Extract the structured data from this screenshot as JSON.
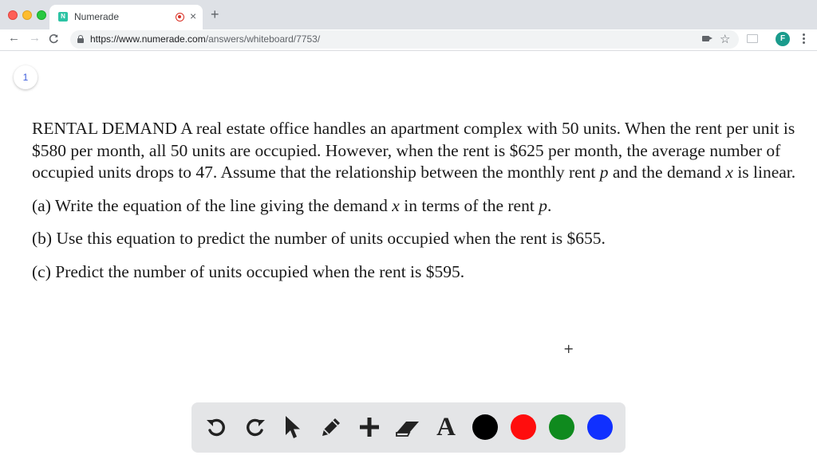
{
  "browser": {
    "tab": {
      "favicon": "N",
      "title": "Numerade",
      "close": "×"
    },
    "new_tab": "+",
    "nav": {
      "back": "←",
      "forward": "→",
      "reload": "C"
    },
    "address": {
      "host": "https://www.numerade.com",
      "path": "/answers/whiteboard/7753/"
    },
    "star": "☆",
    "profile_initial": "F"
  },
  "page": {
    "page_number": "1",
    "problem": {
      "intro_a": "RENTAL DEMAND A real estate office handles an apartment complex with 50 units. When the rent per unit is $580 per month, all 50 units are occupied. However, when the rent is $625 per month, the average number of occupied units drops to 47. Assume that the relationship between the monthly rent ",
      "intro_var_p": "p",
      "intro_b": " and the demand ",
      "intro_var_x": "x",
      "intro_c": " is linear.",
      "part_a_1": "(a) Write the equation of the line giving the demand ",
      "part_a_var_x": "x",
      "part_a_2": " in terms of the rent ",
      "part_a_var_p": "p",
      "part_a_3": ".",
      "part_b": "(b) Use this equation to predict the number of units occupied when the rent is $655.",
      "part_c": "(c) Predict the number of units occupied when the rent is $595."
    },
    "cursor": "+"
  },
  "palette": {
    "tools": [
      "undo-icon",
      "redo-icon",
      "pointer-icon",
      "pen-icon",
      "add-icon",
      "eraser-icon",
      "text-icon"
    ],
    "text_tool_label": "A",
    "colors": [
      "#000000",
      "#ff0d0d",
      "#0f8a1e",
      "#1030ff"
    ]
  }
}
